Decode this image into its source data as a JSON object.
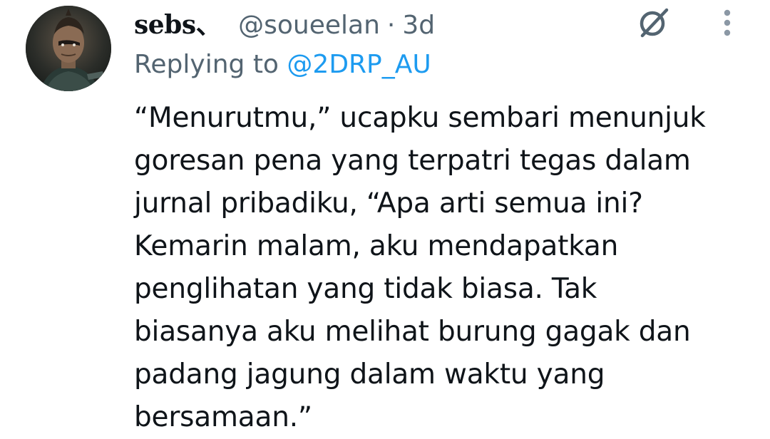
{
  "author": {
    "display_name": "sebs、",
    "handle": "@soueelan",
    "separator": "·",
    "time": "3d"
  },
  "reply": {
    "prefix": "Replying to",
    "to_handle": "@2DRP_AU"
  },
  "tweet": {
    "lines": [
      "“Menurutmu,” ucapku sembari menunjuk",
      "goresan pena yang terpatri tegas dalam",
      "jurnal pribadiku, “Apa arti semua ini?",
      "Kemarin malam, aku mendapatkan",
      "penglihatan yang tidak biasa. Tak",
      "biasanya aku melihat burung gagak dan",
      "padang jagung dalam waktu yang",
      "bersamaan.”"
    ]
  },
  "icons": {
    "avatar": "avatar-photo",
    "grok": "grok-icon",
    "more": "more-vertical-icon"
  },
  "colors": {
    "text": "#0f1419",
    "secondary": "#536471",
    "link": "#1d9bf0",
    "background": "#ffffff"
  }
}
